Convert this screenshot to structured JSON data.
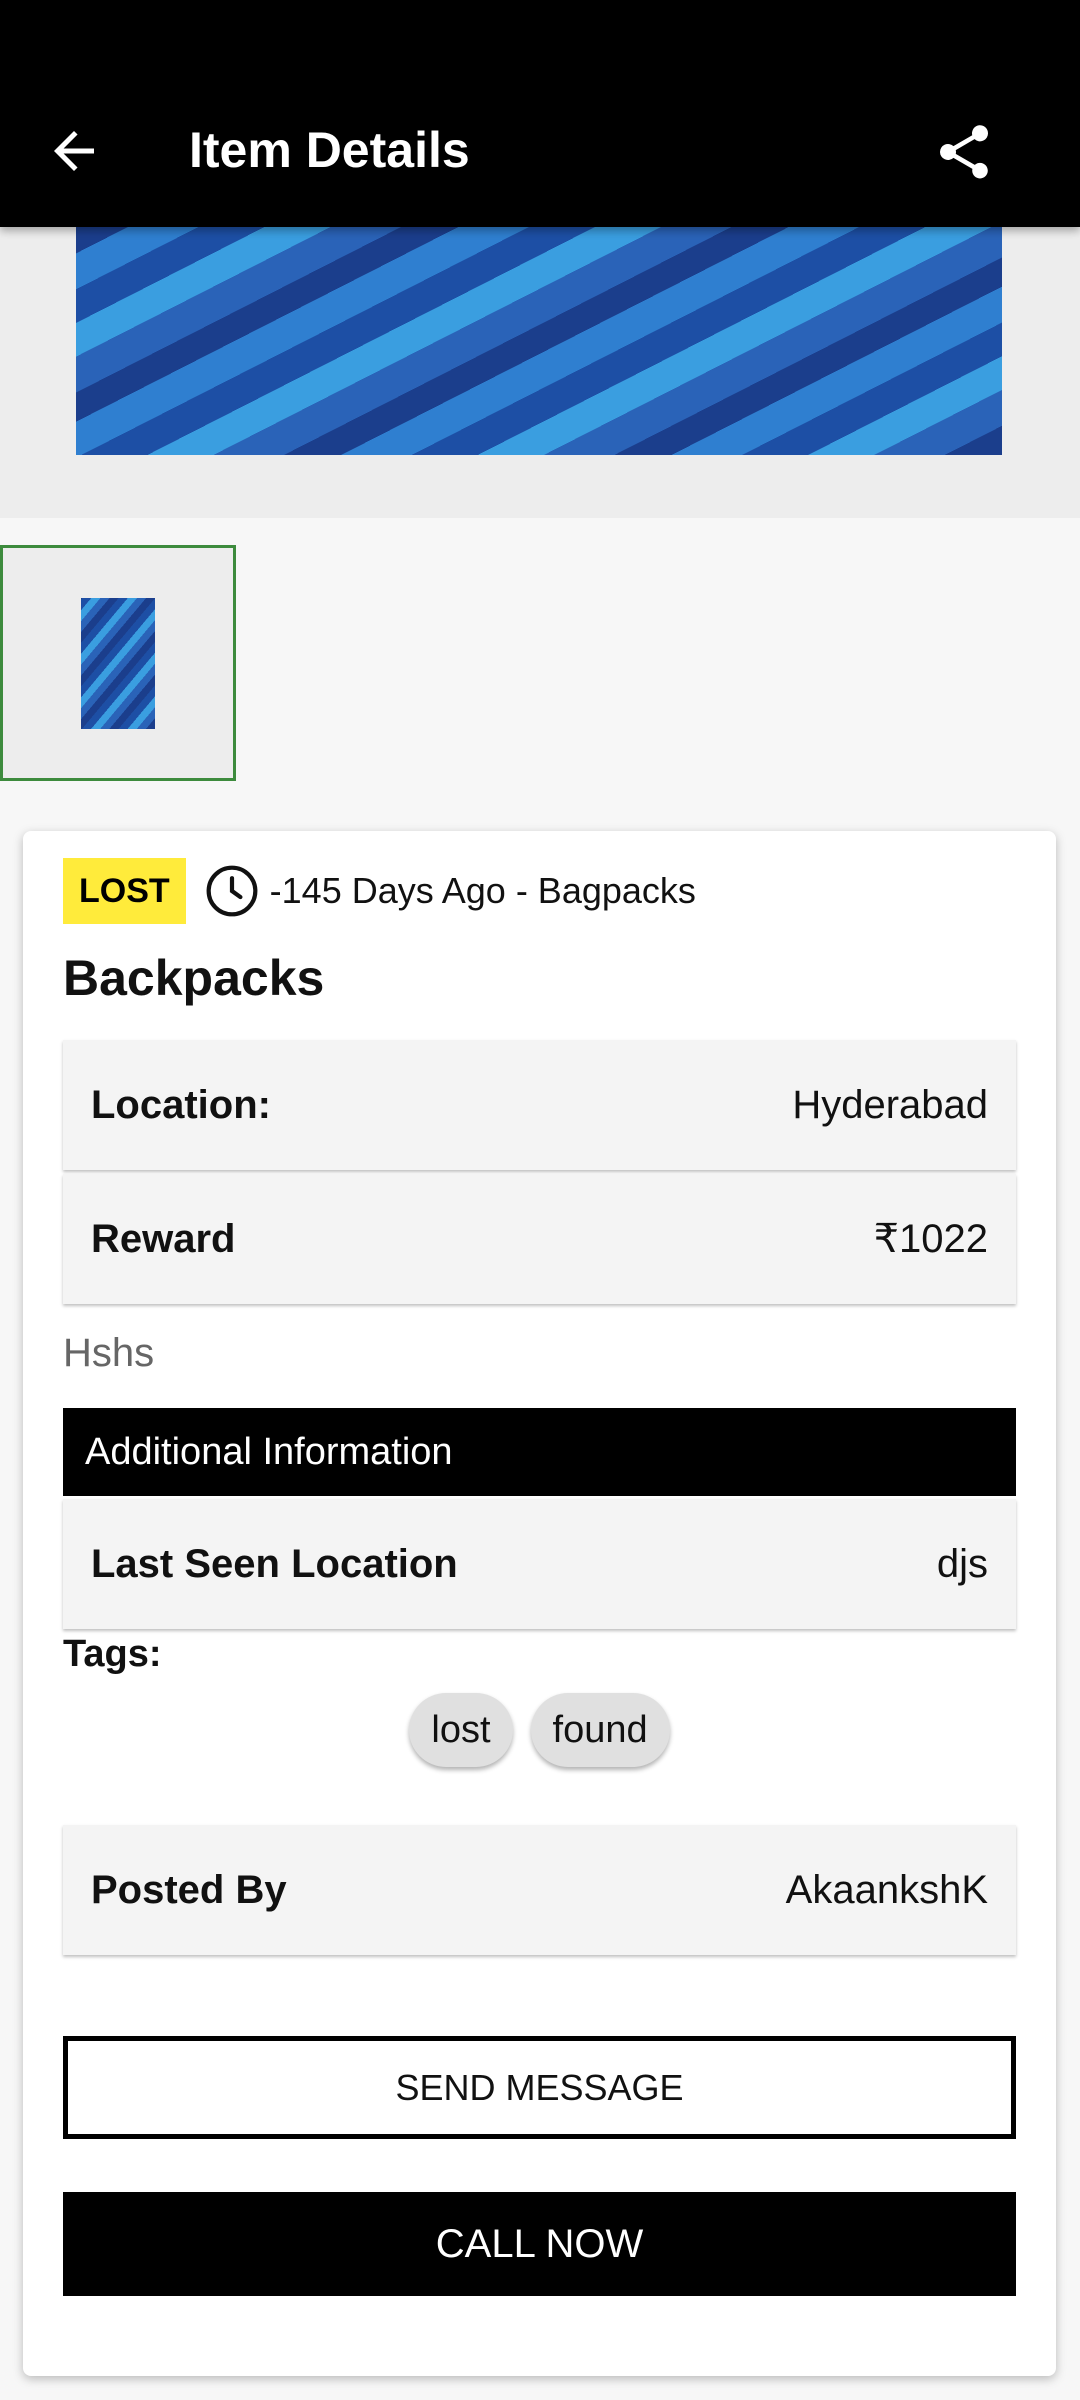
{
  "header": {
    "title": "Item Details",
    "back_icon": "arrow-left-icon",
    "share_icon": "share-icon"
  },
  "gallery": {
    "thumbnail_selected": true
  },
  "item": {
    "status_badge": "LOST",
    "meta": "-145 Days Ago - Bagpacks",
    "title": "Backpacks",
    "location_label": "Location:",
    "location_value": "Hyderabad",
    "reward_label": "Reward",
    "reward_value": "₹1022",
    "description": "Hshs"
  },
  "additional_info": {
    "heading": "Additional Information",
    "last_seen_label": "Last Seen Location",
    "last_seen_value": "djs"
  },
  "tags": {
    "label": "Tags:",
    "items": [
      "lost",
      "found"
    ]
  },
  "posted_by": {
    "label": "Posted By",
    "value": "AkaankshK"
  },
  "actions": {
    "send_message": "SEND MESSAGE",
    "call_now": "CALL NOW"
  },
  "colors": {
    "badge": "#ffeb3b",
    "app_bar": "#000000",
    "thumb_border": "#3d8b3d"
  }
}
